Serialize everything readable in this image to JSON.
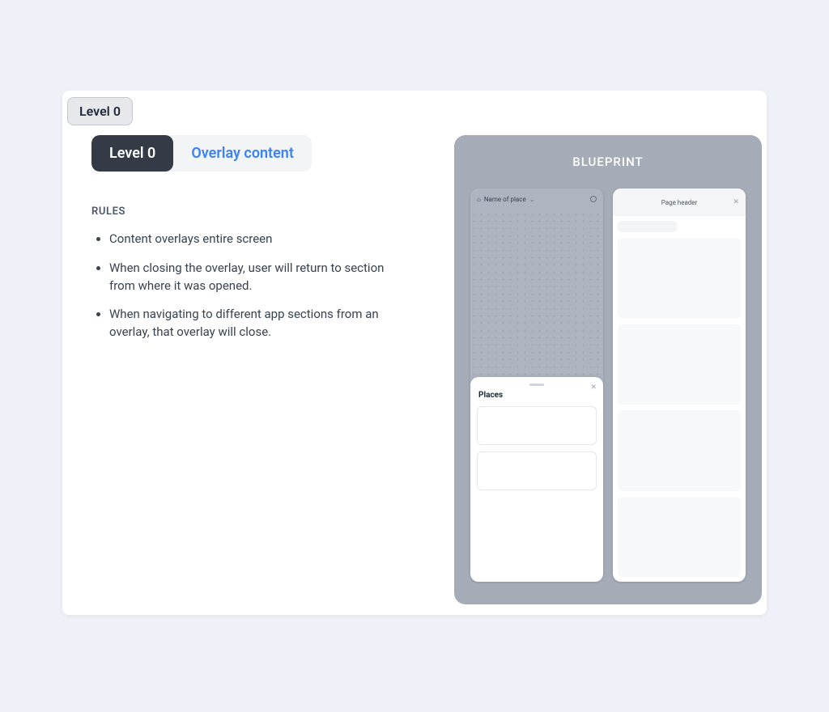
{
  "badge_label": "Level 0",
  "tabs": {
    "active": "Level 0",
    "inactive": "Overlay content"
  },
  "rules_heading": "RULES",
  "rules": [
    "Content overlays entire screen",
    "When closing the overlay, user will return to section from where it was opened.",
    "When navigating to different app sections from an overlay, that overlay will close."
  ],
  "blueprint": {
    "title": "BLUEPRINT",
    "device_a": {
      "header_label": "Name of place",
      "drawer_title": "Places"
    },
    "device_b": {
      "header_label": "Page header"
    }
  }
}
